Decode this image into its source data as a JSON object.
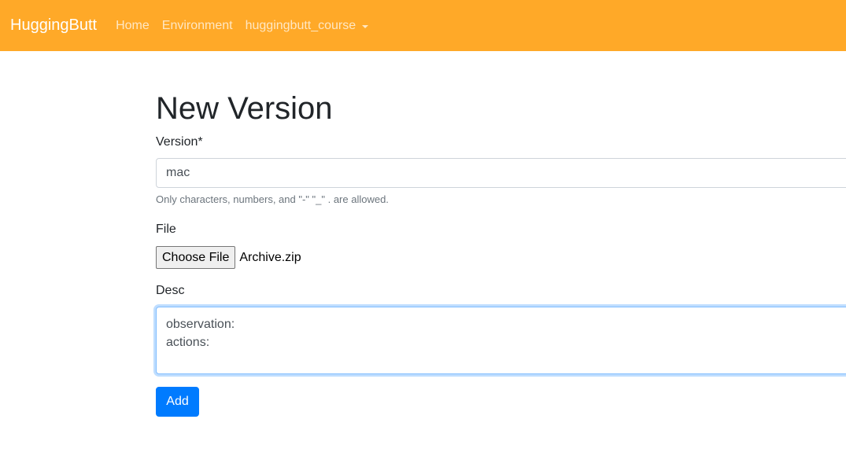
{
  "navbar": {
    "brand": "HuggingButt",
    "links": [
      {
        "label": "Home"
      },
      {
        "label": "Environment"
      },
      {
        "label": "huggingbutt_course"
      }
    ]
  },
  "form": {
    "title": "New Version",
    "version": {
      "label": "Version*",
      "value": "mac",
      "help": "Only characters, numbers, and \"-\" \"_\" . are allowed."
    },
    "file": {
      "label": "File",
      "button_label": "Choose File",
      "file_name": "Archive.zip"
    },
    "desc": {
      "label": "Desc",
      "value": "observation:\nactions:"
    },
    "submit_label": "Add"
  },
  "colors": {
    "navbar_bg": "#ffa928",
    "primary": "#007bff"
  }
}
